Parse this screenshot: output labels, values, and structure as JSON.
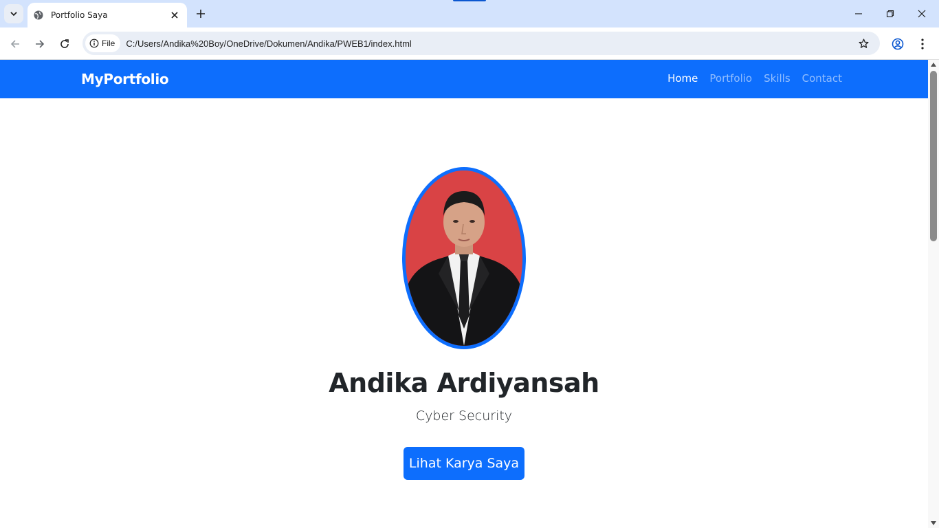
{
  "browser": {
    "tab_title": "Portfolio Saya",
    "site_chip_label": "File",
    "url": "C:/Users/Andika%20Boy/OneDrive/Dokumen/Andika/PWEB1/index.html",
    "icons": [
      "tab-search-icon",
      "globe-icon",
      "close-icon",
      "plus-icon",
      "minimize-icon",
      "restore-icon",
      "window-close-icon",
      "back-arrow-icon",
      "forward-arrow-icon",
      "reload-icon",
      "info-icon",
      "star-icon",
      "profile-icon",
      "menu-dots-icon"
    ]
  },
  "site": {
    "brand": "MyPortfolio",
    "nav": {
      "home": "Home",
      "portfolio": "Portfolio",
      "skills": "Skills",
      "contact": "Contact"
    },
    "hero": {
      "name": "Andika Ardiyansah",
      "role": "Cyber Security",
      "cta": "Lihat Karya Saya"
    }
  },
  "colors": {
    "primary": "#0d6efd",
    "tabstrip": "#d3e3fd",
    "photo_background": "#d94345",
    "text": "#212529"
  }
}
